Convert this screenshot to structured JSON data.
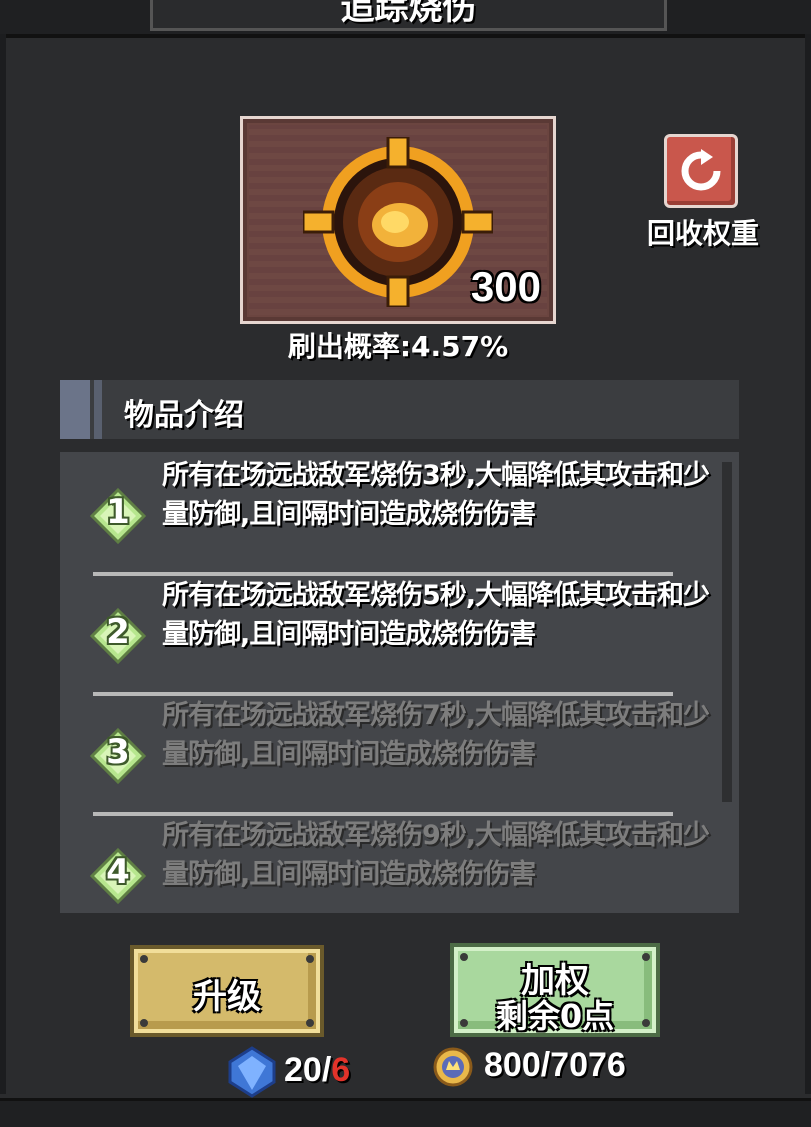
{
  "header": {
    "title": "追踪烧伤"
  },
  "item": {
    "count": "300",
    "drop_rate": "刷出概率:4.57%"
  },
  "recycle": {
    "label": "回收权重"
  },
  "section": {
    "title": "物品介绍"
  },
  "levels": [
    {
      "num": "1",
      "text": "所有在场远战敌军烧伤3秒,大幅降低其攻击和少量防御,且间隔时间造成烧伤伤害",
      "state": "active"
    },
    {
      "num": "2",
      "text": "所有在场远战敌军烧伤5秒,大幅降低其攻击和少量防御,且间隔时间造成烧伤伤害",
      "state": "active"
    },
    {
      "num": "3",
      "text": "所有在场远战敌军烧伤7秒,大幅降低其攻击和少量防御,且间隔时间造成烧伤伤害",
      "state": "inactive"
    },
    {
      "num": "4",
      "text": "所有在场远战敌军烧伤9秒,大幅降低其攻击和少量防御,且间隔时间造成烧伤伤害",
      "state": "inactive"
    }
  ],
  "buttons": {
    "upgrade": "升级",
    "weight_line1": "加权",
    "weight_line2": "剩余0点"
  },
  "resources": {
    "gem_current": "20/",
    "gem_required": "6",
    "coin": "800/7076"
  },
  "colors": {
    "accent_red": "#e2332a",
    "upgrade_gold": "#d4ba6b",
    "weight_green": "#a9d89e"
  }
}
